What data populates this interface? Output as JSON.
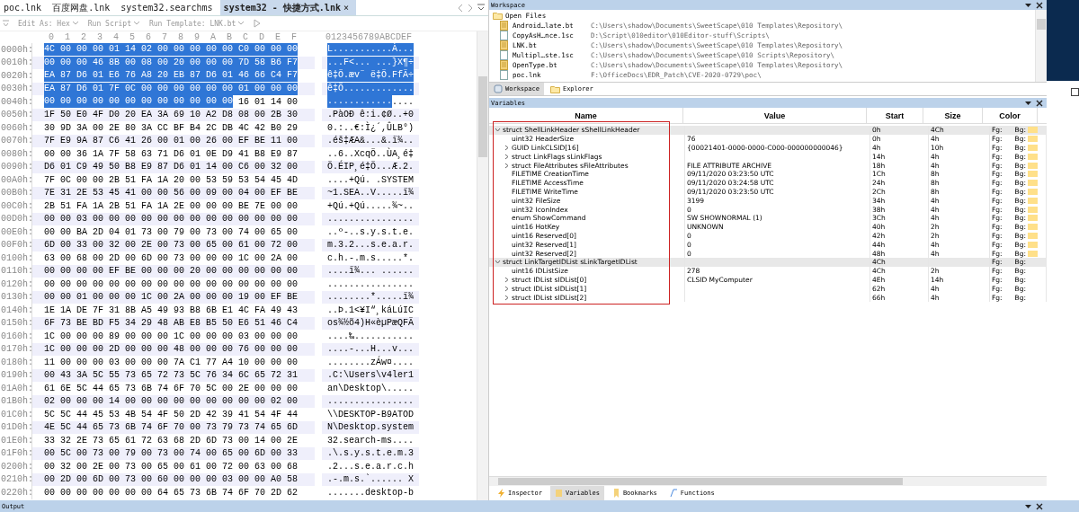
{
  "editor": {
    "tabs": [
      {
        "label": "poc.lnk",
        "selected": false
      },
      {
        "label": "百度网盘.lnk",
        "selected": false
      },
      {
        "label": "system32.searchms",
        "selected": false
      },
      {
        "label": "system32 - 快捷方式.lnk",
        "selected": true,
        "close": "×"
      }
    ],
    "toolbar": [
      {
        "label": "Edit As: Hex",
        "kind": "menu"
      },
      {
        "label": "Run Script",
        "kind": "menu"
      },
      {
        "label": "Run Template: LNK.bt",
        "kind": "menu"
      },
      {
        "kind": "run"
      }
    ],
    "hex_header": {
      "columns": [
        "0",
        "1",
        "2",
        "3",
        "4",
        "5",
        "6",
        "7",
        "8",
        "9",
        "A",
        "B",
        "C",
        "D",
        "E",
        "F"
      ],
      "ascii": "0123456789ABCDEF"
    },
    "rows": [
      {
        "offset": "0000h:",
        "hex_sel": "4C 00 00 00 01 14 02 00 00 00 00 00 C0 00 00 00",
        "hex": "",
        "ascii_sel": "L...........À...",
        "ascii": ""
      },
      {
        "offset": "0010h:",
        "hex_sel": "00 00 00 46 8B 00 08 00 20 00 00 00 7D 58 B6 F7",
        "hex": "",
        "ascii_sel": "...F<... ...}X¶÷",
        "ascii": ""
      },
      {
        "offset": "0020h:",
        "hex_sel": "EA 87 D6 01 E6 76 A8 20 EB 87 D6 01 46 66 C4 F7",
        "hex": "",
        "ascii_sel": "ê‡Ö.æv¨ ë‡Ö.FfÄ÷",
        "ascii": ""
      },
      {
        "offset": "0030h:",
        "hex_sel": "EA 87 D6 01 7F 0C 00 00 00 00 00 00 01 00 00 00",
        "hex": "",
        "ascii_sel": "ê‡Ö.............",
        "ascii": ""
      },
      {
        "offset": "0040h:",
        "hex_sel": "00 00 00 00 00 00 00 00 00 00 00 00",
        "hex": "16 01 14 00",
        "ascii_sel": "............",
        "ascii": "...."
      },
      {
        "offset": "0050h:",
        "hex_sel": "",
        "hex": "1F 50 E0 4F D0 20 EA 3A 69 10 A2 D8 08 00 2B 30",
        "ascii_sel": "",
        "ascii": ".PàOÐ ê:i.¢Ø..+0"
      },
      {
        "offset": "0060h:",
        "hex_sel": "",
        "hex": "30 9D 3A 00 2E 80 3A CC BF B4 2C DB 4C 42 B0 29",
        "ascii_sel": "",
        "ascii": "0.:..€:Ì¿´,ÛLB°)"
      },
      {
        "offset": "0070h:",
        "hex_sel": "",
        "hex": "7F E9 9A 87 C6 41 26 00 01 00 26 00 EF BE 11 00",
        "ascii_sel": "",
        "ascii": ".éš‡ÆA&...&.ï¾.."
      },
      {
        "offset": "0080h:",
        "hex_sel": "",
        "hex": "00 00 36 1A 7F 58 63 71 D6 01 0E D9 41 B8 E9 87",
        "ascii_sel": "",
        "ascii": "..6..XcqÖ..ÙA¸é‡"
      },
      {
        "offset": "0090h:",
        "hex_sel": "",
        "hex": "D6 01 C9 49 50 B8 E9 87 D6 01 14 00 C6 00 32 00",
        "ascii_sel": "",
        "ascii": "Ö.ÉIP¸é‡Ö...Æ.2."
      },
      {
        "offset": "00A0h:",
        "hex_sel": "",
        "hex": "7F 0C 00 00 2B 51 FA 1A 20 00 53 59 53 54 45 4D",
        "ascii_sel": "",
        "ascii": "....+Qú. .SYSTEM"
      },
      {
        "offset": "00B0h:",
        "hex_sel": "",
        "hex": "7E 31 2E 53 45 41 00 00 56 00 09 00 04 00 EF BE",
        "ascii_sel": "",
        "ascii": "~1.SEA..V.....ï¾"
      },
      {
        "offset": "00C0h:",
        "hex_sel": "",
        "hex": "2B 51 FA 1A 2B 51 FA 1A 2E 00 00 00 BE 7E 00 00",
        "ascii_sel": "",
        "ascii": "+Qú.+Qú.....¾~.."
      },
      {
        "offset": "00D0h:",
        "hex_sel": "",
        "hex": "00 00 03 00 00 00 00 00 00 00 00 00 00 00 00 00",
        "ascii_sel": "",
        "ascii": "................"
      },
      {
        "offset": "00E0h:",
        "hex_sel": "",
        "hex": "00 00 BA 2D 04 01 73 00 79 00 73 00 74 00 65 00",
        "ascii_sel": "",
        "ascii": "..º-..s.y.s.t.e."
      },
      {
        "offset": "00F0h:",
        "hex_sel": "",
        "hex": "6D 00 33 00 32 00 2E 00 73 00 65 00 61 00 72 00",
        "ascii_sel": "",
        "ascii": "m.3.2...s.e.a.r."
      },
      {
        "offset": "0100h:",
        "hex_sel": "",
        "hex": "63 00 68 00 2D 00 6D 00 73 00 00 00 1C 00 2A 00",
        "ascii_sel": "",
        "ascii": "c.h.-.m.s.....*."
      },
      {
        "offset": "0110h:",
        "hex_sel": "",
        "hex": "00 00 00 00 EF BE 00 00 00 20 00 00 00 00 00 00",
        "ascii_sel": "",
        "ascii": "....ï¾... ......"
      },
      {
        "offset": "0120h:",
        "hex_sel": "",
        "hex": "00 00 00 00 00 00 00 00 00 00 00 00 00 00 00 00",
        "ascii_sel": "",
        "ascii": "................"
      },
      {
        "offset": "0130h:",
        "hex_sel": "",
        "hex": "00 00 01 00 00 00 1C 00 2A 00 00 00 19 00 EF BE",
        "ascii_sel": "",
        "ascii": "........*.....ï¾"
      },
      {
        "offset": "0140h:",
        "hex_sel": "",
        "hex": "1E 1A DE 7F 31 8B A5 49 93 B8 6B E1 4C FA 49 43",
        "ascii_sel": "",
        "ascii": "..Þ.1<¥I“¸káLúIC"
      },
      {
        "offset": "0150h:",
        "hex_sel": "",
        "hex": "6F 73 BE BD F5 34 29 48 AB E8 B5 50 E6 51 46 C4",
        "ascii_sel": "",
        "ascii": "os¾½õ4)H«èµPæQFÄ"
      },
      {
        "offset": "0160h:",
        "hex_sel": "",
        "hex": "1C 00 00 00 89 00 00 00 1C 00 00 00 03 00 00 00",
        "ascii_sel": "",
        "ascii": "....‰..........."
      },
      {
        "offset": "0170h:",
        "hex_sel": "",
        "hex": "1C 00 00 00 2D 00 00 00 48 00 00 00 76 00 00 00",
        "ascii_sel": "",
        "ascii": "....-...H...v..."
      },
      {
        "offset": "0180h:",
        "hex_sel": "",
        "hex": "11 00 00 00 03 00 00 00 7A C1 77 A4 10 00 00 00",
        "ascii_sel": "",
        "ascii": "........zÁw¤...."
      },
      {
        "offset": "0190h:",
        "hex_sel": "",
        "hex": "00 43 3A 5C 55 73 65 72 73 5C 76 34 6C 65 72 31",
        "ascii_sel": "",
        "ascii": ".C:\\Users\\v4ler1"
      },
      {
        "offset": "01A0h:",
        "hex_sel": "",
        "hex": "61 6E 5C 44 65 73 6B 74 6F 70 5C 00 2E 00 00 00",
        "ascii_sel": "",
        "ascii": "an\\Desktop\\....."
      },
      {
        "offset": "01B0h:",
        "hex_sel": "",
        "hex": "02 00 00 00 14 00 00 00 00 00 00 00 00 00 02 00",
        "ascii_sel": "",
        "ascii": "................"
      },
      {
        "offset": "01C0h:",
        "hex_sel": "",
        "hex": "5C 5C 44 45 53 4B 54 4F 50 2D 42 39 41 54 4F 44",
        "ascii_sel": "",
        "ascii": "\\\\DESKTOP-B9ATOD"
      },
      {
        "offset": "01D0h:",
        "hex_sel": "",
        "hex": "4E 5C 44 65 73 6B 74 6F 70 00 73 79 73 74 65 6D",
        "ascii_sel": "",
        "ascii": "N\\Desktop.system"
      },
      {
        "offset": "01E0h:",
        "hex_sel": "",
        "hex": "33 32 2E 73 65 61 72 63 68 2D 6D 73 00 14 00 2E",
        "ascii_sel": "",
        "ascii": "32.search-ms...."
      },
      {
        "offset": "01F0h:",
        "hex_sel": "",
        "hex": "00 5C 00 73 00 79 00 73 00 74 00 65 00 6D 00 33",
        "ascii_sel": "",
        "ascii": ".\\.s.y.s.t.e.m.3"
      },
      {
        "offset": "0200h:",
        "hex_sel": "",
        "hex": "00 32 00 2E 00 73 00 65 00 61 00 72 00 63 00 68",
        "ascii_sel": "",
        "ascii": ".2...s.e.a.r.c.h"
      },
      {
        "offset": "0210h:",
        "hex_sel": "",
        "hex": "00 2D 00 6D 00 73 00 60 00 00 00 03 00 00 A0 58",
        "ascii_sel": "",
        "ascii": ".-.m.s.`...... X"
      },
      {
        "offset": "0220h:",
        "hex_sel": "",
        "hex": "00 00 00 00 00 00 00 64 65 73 6B 74 6F 70 2D 62",
        "ascii_sel": "",
        "ascii": ".......desktop-b"
      }
    ]
  },
  "workspace": {
    "title": "Workspace",
    "folder": "Open Files",
    "files": [
      {
        "name": "Android…late.bt",
        "path": "C:\\Users\\shadow\\Documents\\SweetScape\\010 Templates\\Repository\\",
        "kind": "template"
      },
      {
        "name": "CopyAsH…nce.1sc",
        "path": "D:\\Script\\010editor\\010Editor-stuff\\Scripts\\",
        "kind": "script"
      },
      {
        "name": "LNK.bt",
        "path": "C:\\Users\\shadow\\Documents\\SweetScape\\010 Templates\\Repository\\",
        "kind": "template"
      },
      {
        "name": "Multipl…ste.1sc",
        "path": "C:\\Users\\shadow\\Documents\\SweetScape\\010 Scripts\\Repository\\",
        "kind": "script"
      },
      {
        "name": "OpenType.bt",
        "path": "C:\\Users\\shadow\\Documents\\SweetScape\\010 Templates\\Repository\\",
        "kind": "template"
      },
      {
        "name": "poc.lnk",
        "path": "F:\\OfficeDocs\\EDR_Patch\\CVE-2020-0729\\poc\\",
        "kind": "script"
      }
    ],
    "tabs": [
      {
        "label": "Workspace",
        "selected": true
      },
      {
        "label": "Explorer",
        "selected": false
      }
    ]
  },
  "variables": {
    "title": "Variables",
    "columns": [
      "Name",
      "Value",
      "Start",
      "Size",
      "Color"
    ],
    "rows": [
      {
        "name": "struct ShellLinkHeader sShellLinkHeader",
        "start": "0h",
        "size": "4Ch",
        "fg": "Fg:",
        "bg": "Bg:",
        "swatch": true,
        "kind": "group",
        "expanded": true,
        "children": [
          {
            "name": "uint32 HeaderSize",
            "value": "76",
            "start": "0h",
            "size": "4h",
            "fg": "Fg:",
            "bg": "Bg:",
            "swatch": true,
            "kind": "field"
          },
          {
            "name": "GUID LinkCLSID[16]",
            "value": "{00021401-0000-0000-C000-000000000046}",
            "start": "4h",
            "size": "10h",
            "fg": "Fg:",
            "bg": "Bg:",
            "swatch": true,
            "kind": "group",
            "expanded": false
          },
          {
            "name": "struct LinkFlags sLinkFlags",
            "start": "14h",
            "size": "4h",
            "fg": "Fg:",
            "bg": "Bg:",
            "swatch": true,
            "kind": "group",
            "expanded": false
          },
          {
            "name": "struct FileAttributes sFileAttributes",
            "value": "FILE ATTRIBUTE ARCHIVE",
            "start": "18h",
            "size": "4h",
            "fg": "Fg:",
            "bg": "Bg:",
            "swatch": true,
            "kind": "group",
            "expanded": false
          },
          {
            "name": "FILETIME CreationTime",
            "value": "09/11/2020 03:23:50 UTC",
            "start": "1Ch",
            "size": "8h",
            "fg": "Fg:",
            "bg": "Bg:",
            "swatch": true,
            "kind": "field"
          },
          {
            "name": "FILETIME AccessTime",
            "value": "09/11/2020 03:24:58 UTC",
            "start": "24h",
            "size": "8h",
            "fg": "Fg:",
            "bg": "Bg:",
            "swatch": true,
            "kind": "field"
          },
          {
            "name": "FILETIME WriteTime",
            "value": "09/11/2020 03:23:50 UTC",
            "start": "2Ch",
            "size": "8h",
            "fg": "Fg:",
            "bg": "Bg:",
            "swatch": true,
            "kind": "field"
          },
          {
            "name": "uint32 FileSize",
            "value": "3199",
            "start": "34h",
            "size": "4h",
            "fg": "Fg:",
            "bg": "Bg:",
            "swatch": true,
            "kind": "field"
          },
          {
            "name": "uint32 IconIndex",
            "value": "0",
            "start": "38h",
            "size": "4h",
            "fg": "Fg:",
            "bg": "Bg:",
            "swatch": true,
            "kind": "field"
          },
          {
            "name": "enum ShowCommand",
            "value": "SW SHOWNORMAL (1)",
            "start": "3Ch",
            "size": "4h",
            "fg": "Fg:",
            "bg": "Bg:",
            "swatch": true,
            "kind": "field"
          },
          {
            "name": "uint16 HotKey",
            "value": "UNKNOWN",
            "start": "40h",
            "size": "2h",
            "fg": "Fg:",
            "bg": "Bg:",
            "swatch": true,
            "kind": "field"
          },
          {
            "name": "uint16 Reserved[0]",
            "value": "0",
            "start": "42h",
            "size": "2h",
            "fg": "Fg:",
            "bg": "Bg:",
            "swatch": true,
            "kind": "field"
          },
          {
            "name": "uint32 Reserved[1]",
            "value": "0",
            "start": "44h",
            "size": "4h",
            "fg": "Fg:",
            "bg": "Bg:",
            "swatch": true,
            "kind": "field"
          },
          {
            "name": "uint32 Reserved[2]",
            "value": "0",
            "start": "48h",
            "size": "4h",
            "fg": "Fg:",
            "bg": "Bg:",
            "swatch": true,
            "kind": "field"
          }
        ]
      },
      {
        "name": "struct LinkTargetIDList sLinkTargetIDList",
        "start": "4Ch",
        "fg": "Fg:",
        "bg": "Bg:",
        "swatch": false,
        "kind": "group",
        "expanded": true,
        "children": [
          {
            "name": "uint16 IDListSize",
            "value": "278",
            "start": "4Ch",
            "size": "2h",
            "fg": "Fg:",
            "bg": "Bg:",
            "swatch": false,
            "kind": "field"
          },
          {
            "name": "struct IDList sIDList[0]",
            "value": "CLSID MyComputer",
            "start": "4Eh",
            "size": "14h",
            "fg": "Fg:",
            "bg": "Bg:",
            "swatch": false,
            "kind": "group",
            "expanded": false
          },
          {
            "name": "struct IDList sIDList[1]",
            "start": "62h",
            "size": "4h",
            "fg": "Fg:",
            "bg": "Bg:",
            "swatch": false,
            "kind": "group",
            "expanded": false
          },
          {
            "name": "struct IDList sIDList[2]",
            "start": "66h",
            "size": "4h",
            "fg": "Fg:",
            "bg": "Bg:",
            "swatch": false,
            "kind": "group",
            "expanded": false
          }
        ]
      }
    ]
  },
  "bottom_tabs": [
    {
      "label": "Inspector",
      "selected": false
    },
    {
      "label": "Variables",
      "selected": true
    },
    {
      "label": "Bookmarks",
      "selected": false
    },
    {
      "label": "Functions",
      "selected": false
    }
  ],
  "output": {
    "title": "Output"
  }
}
